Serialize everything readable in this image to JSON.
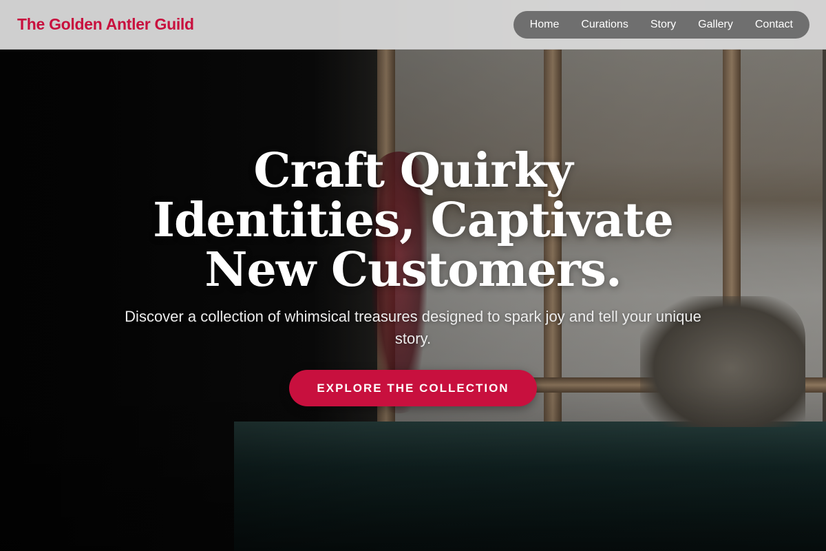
{
  "header": {
    "brand": "The Golden Antler Guild",
    "nav": [
      {
        "label": "Home"
      },
      {
        "label": "Curations"
      },
      {
        "label": "Story"
      },
      {
        "label": "Gallery"
      },
      {
        "label": "Contact"
      }
    ]
  },
  "hero": {
    "headline": "Craft Quirky Identities, Captivate New Customers.",
    "subtext": "Discover a collection of whimsical treasures designed to spark joy and tell your unique story.",
    "cta_label": "EXPLORE THE COLLECTION"
  },
  "colors": {
    "accent": "#c8103e",
    "header_bg": "#dcdcdc",
    "nav_bg": "#6f6f6f"
  }
}
